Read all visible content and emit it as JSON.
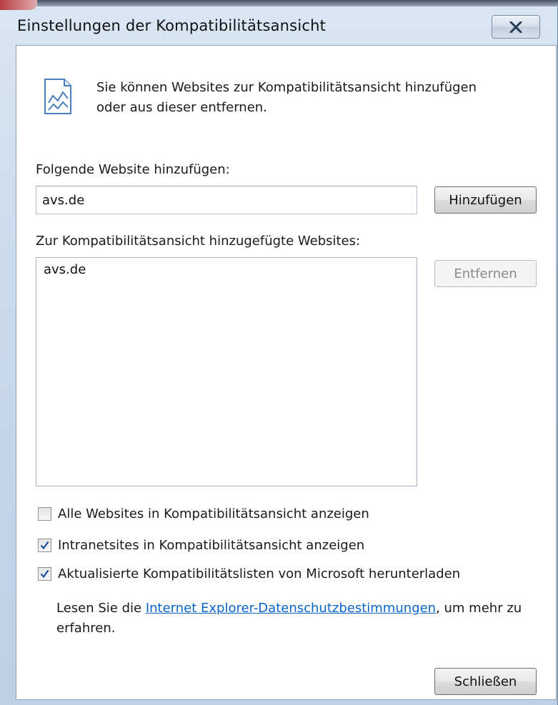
{
  "window": {
    "title": "Einstellungen der Kompatibilitätsansicht",
    "close_label": "X"
  },
  "info": {
    "text_line1": "Sie können Websites zur Kompatibilitätsansicht hinzufügen",
    "text_line2": "oder aus dieser entfernen."
  },
  "add_section": {
    "label": "Folgende Website hinzufügen:",
    "input_value": "avs.de",
    "add_button": "Hinzufügen"
  },
  "list_section": {
    "label": "Zur Kompatibilitätsansicht hinzugefügte Websites:",
    "items": [
      "avs.de"
    ],
    "remove_button": "Entfernen"
  },
  "options": [
    {
      "label": "Alle Websites in Kompatibilitätsansicht anzeigen",
      "checked": false
    },
    {
      "label": "Intranetsites in Kompatibilitätsansicht anzeigen",
      "checked": true
    },
    {
      "label": "Aktualisierte Kompatibilitätslisten von Microsoft herunterladen",
      "checked": true
    }
  ],
  "privacy": {
    "prefix": "Lesen Sie die ",
    "link_text": "Internet Explorer-Datenschutzbestimmungen",
    "suffix": ", um mehr zu",
    "line2": "erfahren."
  },
  "footer": {
    "close_button": "Schließen"
  },
  "colors": {
    "link": "#0a64c8",
    "check": "#1d4fa3"
  }
}
